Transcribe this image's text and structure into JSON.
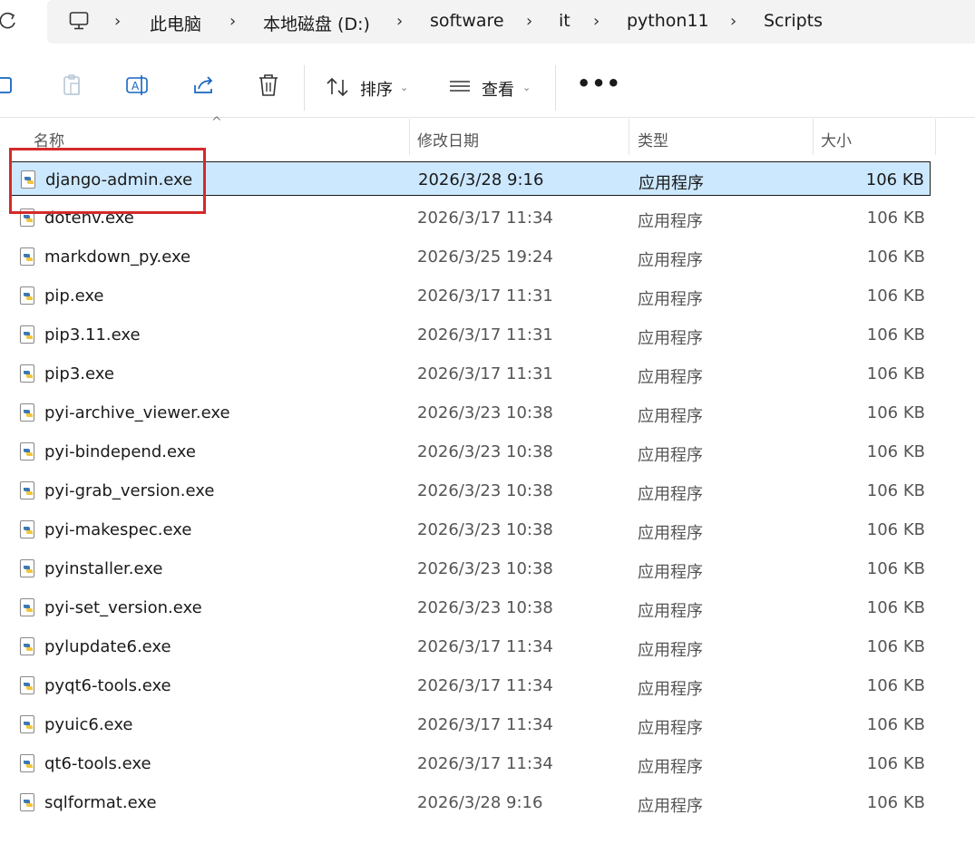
{
  "breadcrumbs": [
    "此电脑",
    "本地磁盘 (D:)",
    "software",
    "it",
    "python11",
    "Scripts"
  ],
  "toolbar": {
    "sort_label": "排序",
    "view_label": "查看",
    "more_label": "•••"
  },
  "columns": {
    "name": "名称",
    "date": "修改日期",
    "type": "类型",
    "size": "大小"
  },
  "files": [
    {
      "name": "django-admin.exe",
      "date": "2026/3/28 9:16",
      "type": "应用程序",
      "size": "106 KB",
      "selected": true
    },
    {
      "name": "dotenv.exe",
      "date": "2026/3/17 11:34",
      "type": "应用程序",
      "size": "106 KB"
    },
    {
      "name": "markdown_py.exe",
      "date": "2026/3/25 19:24",
      "type": "应用程序",
      "size": "106 KB"
    },
    {
      "name": "pip.exe",
      "date": "2026/3/17 11:31",
      "type": "应用程序",
      "size": "106 KB"
    },
    {
      "name": "pip3.11.exe",
      "date": "2026/3/17 11:31",
      "type": "应用程序",
      "size": "106 KB"
    },
    {
      "name": "pip3.exe",
      "date": "2026/3/17 11:31",
      "type": "应用程序",
      "size": "106 KB"
    },
    {
      "name": "pyi-archive_viewer.exe",
      "date": "2026/3/23 10:38",
      "type": "应用程序",
      "size": "106 KB"
    },
    {
      "name": "pyi-bindepend.exe",
      "date": "2026/3/23 10:38",
      "type": "应用程序",
      "size": "106 KB"
    },
    {
      "name": "pyi-grab_version.exe",
      "date": "2026/3/23 10:38",
      "type": "应用程序",
      "size": "106 KB"
    },
    {
      "name": "pyi-makespec.exe",
      "date": "2026/3/23 10:38",
      "type": "应用程序",
      "size": "106 KB"
    },
    {
      "name": "pyinstaller.exe",
      "date": "2026/3/23 10:38",
      "type": "应用程序",
      "size": "106 KB"
    },
    {
      "name": "pyi-set_version.exe",
      "date": "2026/3/23 10:38",
      "type": "应用程序",
      "size": "106 KB"
    },
    {
      "name": "pylupdate6.exe",
      "date": "2026/3/17 11:34",
      "type": "应用程序",
      "size": "106 KB"
    },
    {
      "name": "pyqt6-tools.exe",
      "date": "2026/3/17 11:34",
      "type": "应用程序",
      "size": "106 KB"
    },
    {
      "name": "pyuic6.exe",
      "date": "2026/3/17 11:34",
      "type": "应用程序",
      "size": "106 KB"
    },
    {
      "name": "qt6-tools.exe",
      "date": "2026/3/17 11:34",
      "type": "应用程序",
      "size": "106 KB"
    },
    {
      "name": "sqlformat.exe",
      "date": "2026/3/28 9:16",
      "type": "应用程序",
      "size": "106 KB"
    }
  ],
  "icons": {
    "file": "python-exe-icon",
    "refresh": "refresh-icon",
    "pc": "monitor-icon"
  }
}
